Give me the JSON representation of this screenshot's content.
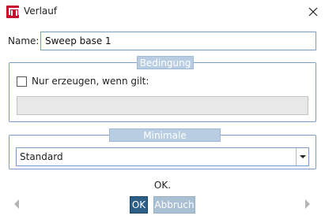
{
  "window": {
    "title": "Verlauf"
  },
  "name": {
    "label": "Name:",
    "value": "Sweep base 1"
  },
  "condition": {
    "legend": "Bedingung",
    "checkbox_label": "Nur erzeugen, wenn gilt:",
    "checked": false,
    "value": ""
  },
  "rasterization": {
    "legend": "Minimale Aufrasterung:",
    "selected": "Standard"
  },
  "status": "OK.",
  "buttons": {
    "ok": "OK",
    "cancel": "Abbruch"
  },
  "icons": {
    "app": "verlauf-app-icon",
    "close": "close-icon",
    "prev": "arrow-left-icon",
    "next": "arrow-right-icon",
    "dropdown": "chevron-down-icon"
  },
  "colors": {
    "app_icon": "#c8102e",
    "border": "#7a9cc6",
    "legend_bg": "#b9cde2",
    "ok_button": "#2d5f86",
    "cancel_button": "#a9bfd4",
    "disabled_field": "#e8e8e8",
    "nav_arrow": "#b5b5b5"
  }
}
